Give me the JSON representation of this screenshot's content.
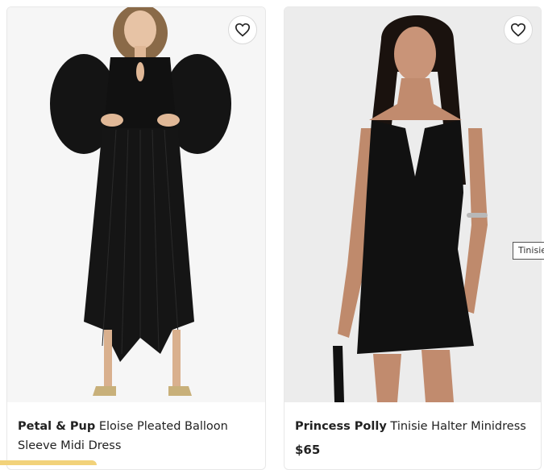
{
  "products": [
    {
      "brand": "Petal & Pup",
      "name": "Eloise Pleated Balloon Sleeve Midi Dress",
      "price": ""
    },
    {
      "brand": "Princess Polly",
      "name": "Tinisie Halter Minidress",
      "price": "$65"
    }
  ],
  "tooltip": {
    "text": "Tinisie"
  },
  "icons": {
    "favorite": "heart-outline-icon"
  },
  "colors": {
    "accent_strip": "#f2d27a",
    "text": "#222222"
  }
}
